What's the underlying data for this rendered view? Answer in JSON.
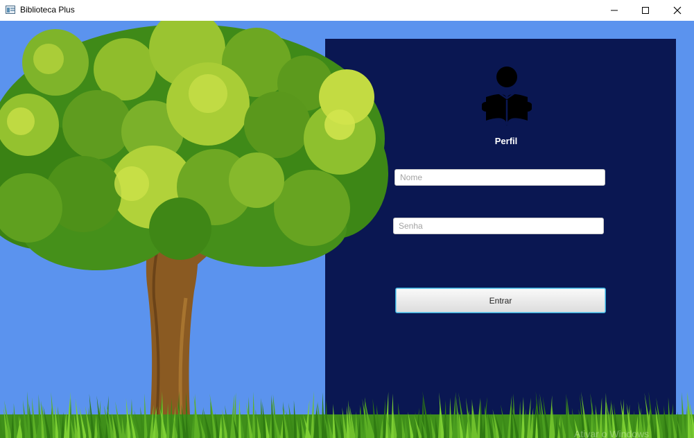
{
  "window": {
    "title": "Biblioteca Plus",
    "controls": [
      "minimize",
      "maximize",
      "close"
    ]
  },
  "login": {
    "profile_label": "Perfil",
    "name_placeholder": "Nome",
    "password_placeholder": "Senha",
    "submit_label": "Entrar"
  },
  "overlay": {
    "watermark": "Ativar o Windows"
  },
  "colors": {
    "background_sky": "#5b93ee",
    "panel": "#0a1752",
    "panel_text": "#ffffff",
    "button_border": "#2fa6d3"
  },
  "icons": {
    "app": "app-window-icon",
    "profile": "reader-person-icon"
  }
}
